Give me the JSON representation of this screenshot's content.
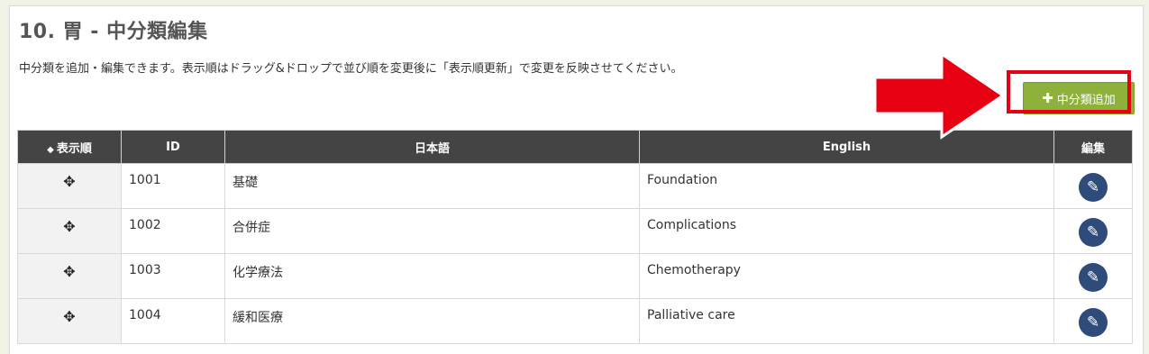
{
  "page": {
    "title": "10. 胃 - 中分類編集",
    "description": "中分類を追加・編集できます。表示順はドラッグ&ドロップで並び順を変更後に「表示順更新」で変更を反映させてください。",
    "add_button_label": "中分類追加"
  },
  "table": {
    "headers": {
      "order": "表示順",
      "id": "ID",
      "japanese": "日本語",
      "english": "English",
      "edit": "編集"
    },
    "rows": [
      {
        "id": "1001",
        "japanese": "基礎",
        "english": "Foundation"
      },
      {
        "id": "1002",
        "japanese": "合併症",
        "english": "Complications"
      },
      {
        "id": "1003",
        "japanese": "化学療法",
        "english": "Chemotherapy"
      },
      {
        "id": "1004",
        "japanese": "緩和医療",
        "english": "Palliative care"
      }
    ]
  },
  "icons": {
    "sort": "sort-icon",
    "move": "move-icon",
    "edit": "pencil-icon",
    "add": "plus-icon"
  },
  "colors": {
    "accent_green": "#8db13a",
    "header_dark": "#444444",
    "edit_blue": "#2e4b7a",
    "annotation_red": "#e60012"
  }
}
